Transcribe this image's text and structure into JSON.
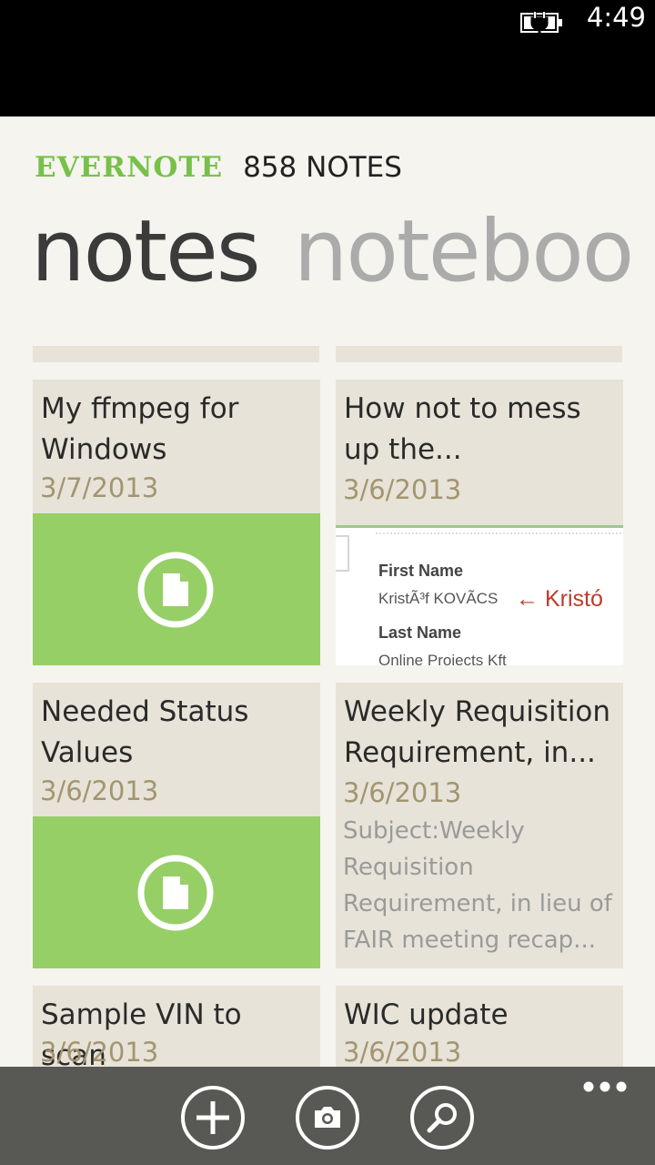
{
  "status": {
    "time": "4:49"
  },
  "header": {
    "logo": "EVERNOTE",
    "count": "858 NOTES"
  },
  "pivot": {
    "active": "notes",
    "inactive": "noteboo"
  },
  "notes": [
    {
      "title": "My ffmpeg for Windows",
      "date": "3/7/2013",
      "preview": "document"
    },
    {
      "title": "How not to mess up the...",
      "date": "3/6/2013",
      "preview": "image",
      "image_text": {
        "label1": "First Name",
        "value1": "KristÃ³f KOVÃCS",
        "arrow_text": "← Kristó",
        "label2": "Last Name",
        "value2": "Online Projects Kft"
      }
    },
    {
      "title": "Needed Status Values",
      "date": "3/6/2013",
      "preview": "document"
    },
    {
      "title": "Weekly Requisition Requirement, in...",
      "date": "3/6/2013",
      "snippet": "Subject:Weekly Requisition Requirement, in lieu of FAIR meeting recap..."
    },
    {
      "title": "Sample VIN to scan",
      "date": "3/6/2013"
    },
    {
      "title": "WIC update",
      "date": "3/6/2013"
    }
  ],
  "appbar": {
    "buttons": [
      "add-note",
      "camera",
      "search"
    ],
    "more": "ellipsis"
  },
  "colors": {
    "accent_green": "#78c04a",
    "tile_green": "#96cf66",
    "tile_bg": "#e7e3d8",
    "date_color": "#a39570",
    "appbar_bg": "#585855"
  }
}
